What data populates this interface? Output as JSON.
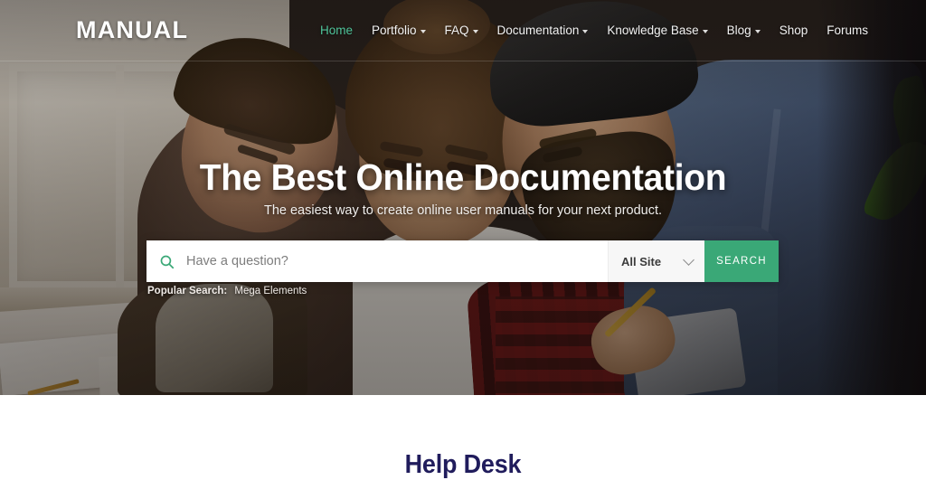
{
  "site": {
    "logo": "MANUAL",
    "accent_green": "#3aa877",
    "nav_active_green": "#4fc49a",
    "heading_navy": "#201c5c"
  },
  "nav": {
    "items": [
      {
        "label": "Home",
        "has_dropdown": false,
        "active": true
      },
      {
        "label": "Portfolio",
        "has_dropdown": true,
        "active": false
      },
      {
        "label": "FAQ",
        "has_dropdown": true,
        "active": false
      },
      {
        "label": "Documentation",
        "has_dropdown": true,
        "active": false
      },
      {
        "label": "Knowledge Base",
        "has_dropdown": true,
        "active": false
      },
      {
        "label": "Blog",
        "has_dropdown": true,
        "active": false
      },
      {
        "label": "Shop",
        "has_dropdown": false,
        "active": false
      },
      {
        "label": "Forums",
        "has_dropdown": false,
        "active": false
      }
    ]
  },
  "hero": {
    "title": "The Best Online Documentation",
    "subtitle": "The easiest way to create online user manuals for your next product.",
    "search": {
      "icon": "search-icon",
      "placeholder": "Have a question?",
      "value": "",
      "scope_selected": "All Site",
      "scope_chevron": "chevron-down-icon",
      "button_label": "SEARCH"
    },
    "popular": {
      "label": "Popular Search:",
      "terms": "Mega Elements"
    }
  },
  "section": {
    "title": "Help Desk"
  }
}
